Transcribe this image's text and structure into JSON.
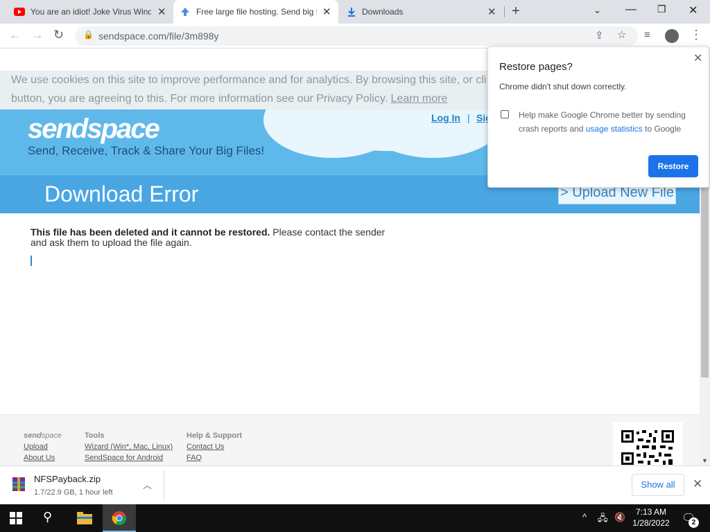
{
  "browser": {
    "tabs": [
      {
        "title": "You are an idiot! Joke Virus Wind",
        "favicon": "youtube-icon"
      },
      {
        "title": "Free large file hosting. Send big f",
        "favicon": "sendspace-icon"
      },
      {
        "title": "Downloads",
        "favicon": "download-icon"
      }
    ],
    "url": "sendspace.com/file/3m898y"
  },
  "cookie": {
    "text_line1": "We use cookies on this site to improve performance and for analytics. By browsing this site, or cli",
    "text_line2": "button, you are agreeing to this. For more information see our Privacy Policy.",
    "learn_more": "Learn more"
  },
  "site": {
    "logo": "sendspace",
    "tagline": "Send, Receive, Track & Share Your Big Files!",
    "login": "Log In",
    "signup": "Sig",
    "heading": "Download Error",
    "upload_new": "> Upload New File",
    "message_bold": "This file has been deleted and it cannot be restored.",
    "message_rest": " Please contact the sender and ask them to upload the file again."
  },
  "footer": {
    "col1": {
      "head_a": "send",
      "head_b": "space",
      "links": [
        "Upload",
        "About Us"
      ]
    },
    "col2": {
      "head": "Tools",
      "links": [
        "Wizard (Win*, Mac, Linux)",
        "SendSpace for Android"
      ]
    },
    "col3": {
      "head": "Help & Support",
      "links": [
        "Contact Us",
        "FAQ"
      ]
    }
  },
  "popup": {
    "title": "Restore pages?",
    "subtitle": "Chrome didn't shut down correctly.",
    "checkbox_text": "Help make Google Chrome better by sending crash reports and",
    "checkbox_link": "usage statistics",
    "checkbox_tail": "to Google",
    "checked": false,
    "button": "Restore"
  },
  "download": {
    "filename": "NFSPayback.zip",
    "status": "1.7/22.9 GB, 1 hour left",
    "show_all": "Show all"
  },
  "taskbar": {
    "time": "7:13 AM",
    "date": "1/28/2022",
    "notifications": "2"
  },
  "colors": {
    "header_blue": "#5fb8ea",
    "chrome_blue": "#1a73e8"
  }
}
